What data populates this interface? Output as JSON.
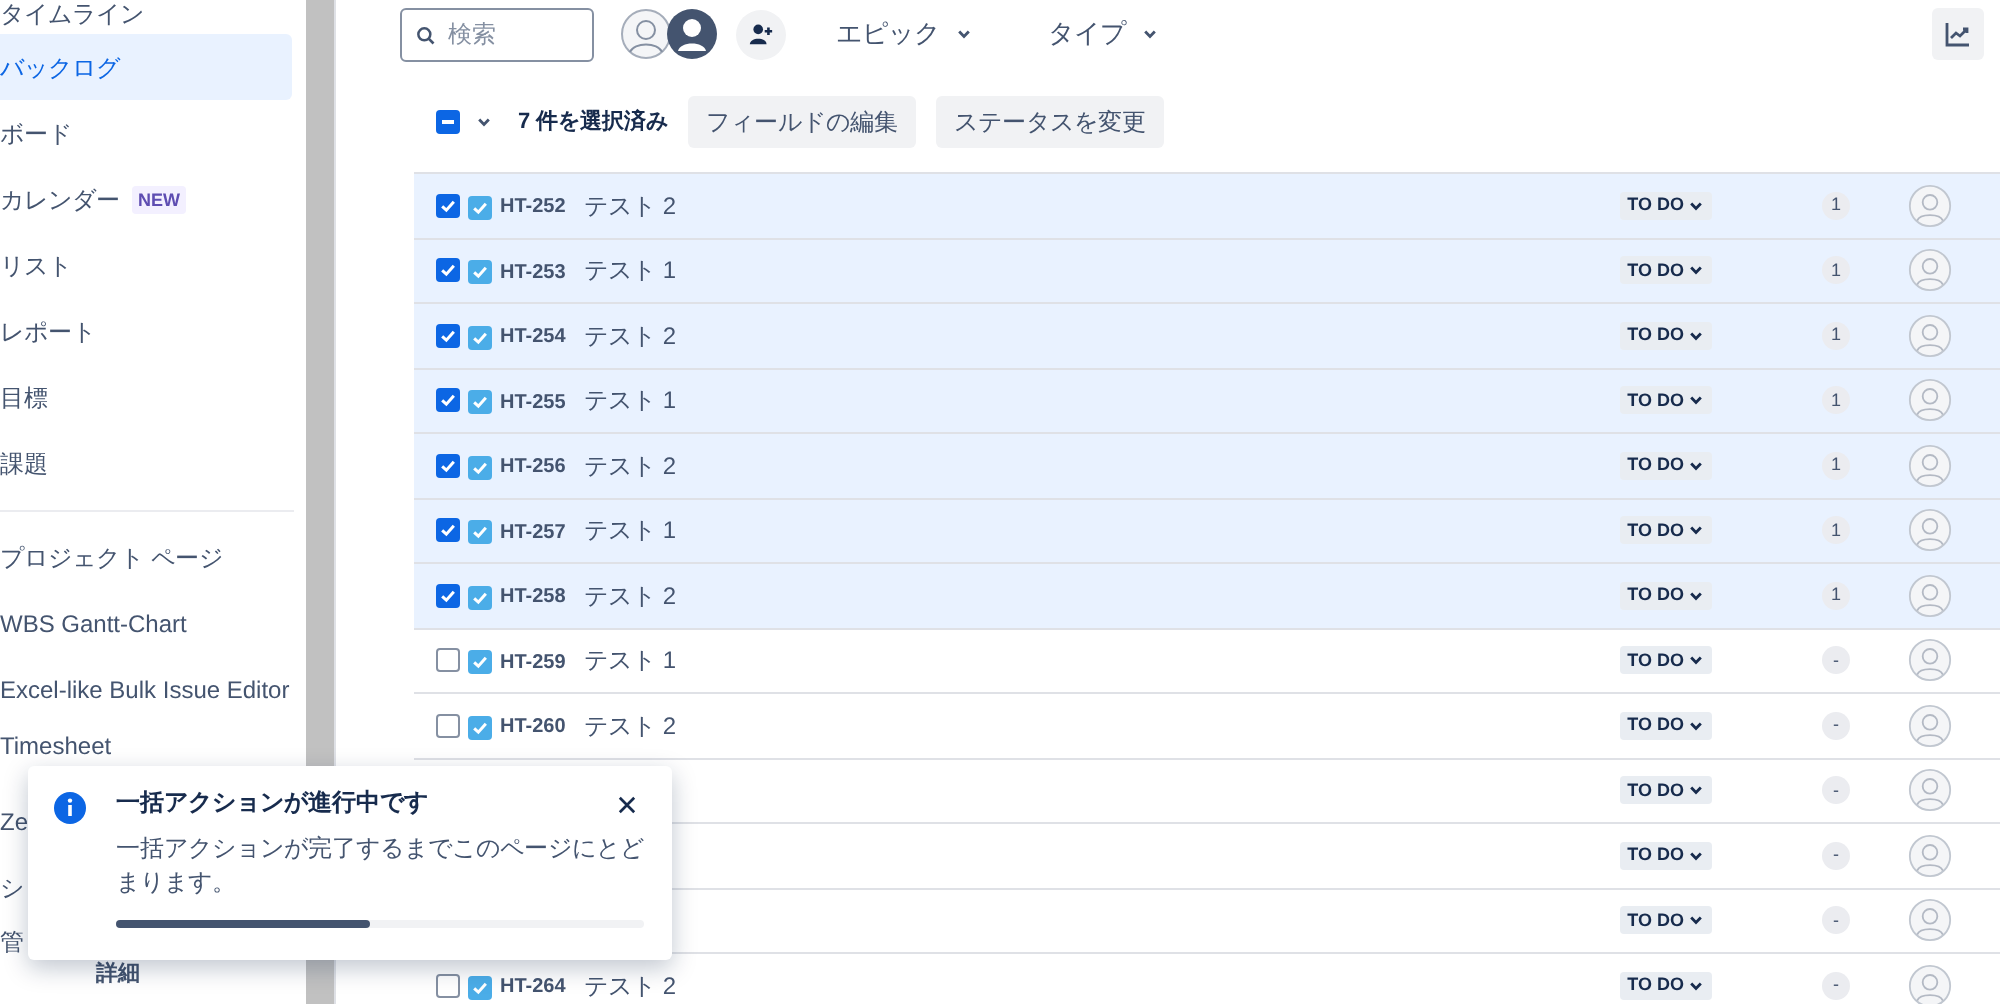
{
  "sidebar": {
    "items": [
      {
        "label": "タイムライン",
        "selected": false
      },
      {
        "label": "バックログ",
        "selected": true
      },
      {
        "label": "ボード",
        "selected": false
      },
      {
        "label": "カレンダー",
        "badge": "NEW",
        "selected": false
      },
      {
        "label": "リスト",
        "selected": false
      },
      {
        "label": "レポート",
        "selected": false
      },
      {
        "label": "目標",
        "selected": false
      },
      {
        "label": "課題",
        "selected": false
      },
      {
        "kind": "divider"
      },
      {
        "label": "プロジェクト ページ",
        "selected": false
      },
      {
        "label": "WBS Gantt-Chart",
        "selected": false
      },
      {
        "label": "Excel-like Bulk Issue Editor",
        "selected": false
      },
      {
        "label": "Timesheet",
        "selected": false
      },
      {
        "label": "Ze",
        "selected": false
      },
      {
        "label": "シ",
        "selected": false
      },
      {
        "label": "管",
        "selected": false
      }
    ],
    "sub_item": "詳細"
  },
  "toolbar": {
    "search_placeholder": "検索",
    "filters": [
      "エピック",
      "タイプ"
    ]
  },
  "selection": {
    "indeterminate": true,
    "count": "7 件を選択済み",
    "actions": [
      "フィールドの編集",
      "ステータスを変更"
    ]
  },
  "rows": [
    {
      "selected": true,
      "key": "HT-252",
      "summary": "テスト 2",
      "status": "TO DO",
      "estimate": "1"
    },
    {
      "selected": true,
      "key": "HT-253",
      "summary": "テスト 1",
      "status": "TO DO",
      "estimate": "1"
    },
    {
      "selected": true,
      "key": "HT-254",
      "summary": "テスト 2",
      "status": "TO DO",
      "estimate": "1"
    },
    {
      "selected": true,
      "key": "HT-255",
      "summary": "テスト 1",
      "status": "TO DO",
      "estimate": "1"
    },
    {
      "selected": true,
      "key": "HT-256",
      "summary": "テスト 2",
      "status": "TO DO",
      "estimate": "1"
    },
    {
      "selected": true,
      "key": "HT-257",
      "summary": "テスト 1",
      "status": "TO DO",
      "estimate": "1"
    },
    {
      "selected": true,
      "key": "HT-258",
      "summary": "テスト 2",
      "status": "TO DO",
      "estimate": "1"
    },
    {
      "selected": false,
      "key": "HT-259",
      "summary": "テスト 1",
      "status": "TO DO",
      "estimate": "-"
    },
    {
      "selected": false,
      "key": "HT-260",
      "summary": "テスト 2",
      "status": "TO DO",
      "estimate": "-"
    },
    {
      "status": "TO DO",
      "estimate": "-"
    },
    {
      "status": "TO DO",
      "estimate": "-"
    },
    {
      "status": "TO DO",
      "estimate": "-"
    },
    {
      "selected": false,
      "key": "HT-264",
      "summary": "テスト 2",
      "status": "TO DO",
      "estimate": "-"
    }
  ],
  "toast": {
    "title": "一括アクションが進行中です",
    "message": "一括アクションが完了するまでこのページにとどまります。",
    "level": 0.48
  }
}
